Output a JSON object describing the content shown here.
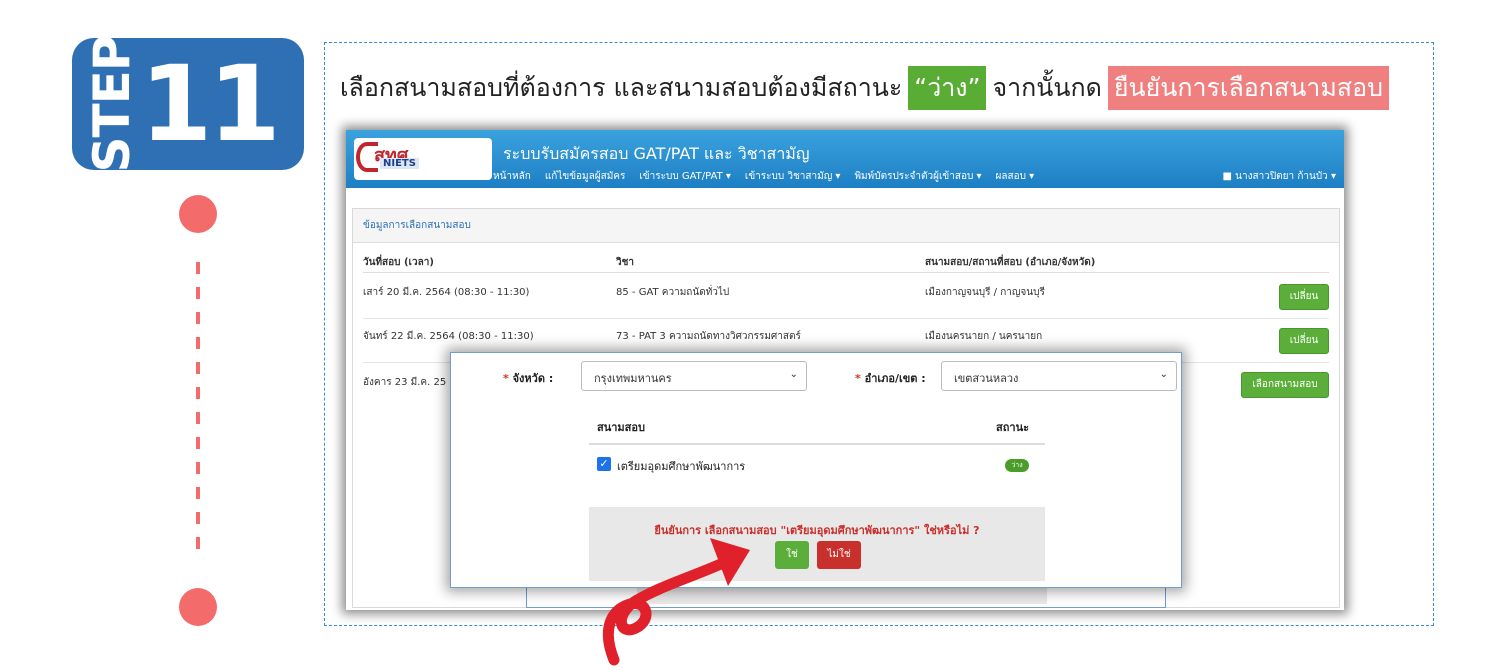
{
  "step": {
    "word": "STEP",
    "number": "11"
  },
  "instruction": {
    "prefix": "เลือกสนามสอบที่ต้องการ และสนามสอบต้องมีสถานะ",
    "status_word": "“ว่าง”",
    "middle": "จากนั้นกด",
    "action": "ยืนยันการเลือกสนามสอบ"
  },
  "navbar": {
    "logo_text": "สทศ",
    "logo_sub": "NIETS",
    "title": "ระบบรับสมัครสอบ GAT/PAT และ วิชาสามัญ",
    "menu": [
      "หน้าหลัก",
      "แก้ไขข้อมูลผู้สมัคร",
      "เข้าระบบ GAT/PAT ▾",
      "เข้าระบบ วิชาสามัญ ▾",
      "พิมพ์บัตรประจำตัวผู้เข้าสอบ ▾",
      "ผลสอบ ▾"
    ],
    "user": "นางสาวปิตยา ก้านบัว ▾"
  },
  "panel": {
    "title": "ข้อมูลการเลือกสนามสอบ",
    "headers": [
      "วันที่สอบ (เวลา)",
      "วิชา",
      "สนามสอบ/สถานที่สอบ (อำเภอ/จังหวัด)"
    ],
    "rows": [
      {
        "date": "เสาร์ 20 มี.ค. 2564   (08:30 - 11:30)",
        "subject": "85 - GAT ความถนัดทั่วไป",
        "venue": "เมืองกาญจนบุรี  /  กาญจนบุรี",
        "button": "เปลี่ยน"
      },
      {
        "date": "จันทร์ 22 มี.ค. 2564   (08:30 - 11:30)",
        "subject": "73 - PAT 3 ความถนัดทางวิศวกรรมศาสตร์",
        "venue": "เมืองนครนายก  /  นครนายก",
        "button": "เปลี่ยน"
      },
      {
        "date": "อังคาร 23 มี.ค. 25",
        "subject": "",
        "venue": "",
        "button": "เลือกสนามสอบ"
      }
    ]
  },
  "modal": {
    "province_label": "จังหวัด :",
    "province_value": "กรุงเทพมหานคร",
    "district_label": "อำเภอ/เขต :",
    "district_value": "เขตสวนหลวง",
    "required_mark": "*",
    "table_headers": [
      "สนามสอบ",
      "สถานะ"
    ],
    "venue_name": "เตรียมอุดมศึกษาพัฒนาการ",
    "venue_status": "ว่าง",
    "confirm_text": "ยืนยันการ เลือกสนามสอบ \"เตรียมอุดมศึกษาพัฒนาการ\" ใช่หรือไม่ ?",
    "yes": "ใช่",
    "no": "ไม่ใช่"
  },
  "colors": {
    "badge": "#2f70b4",
    "timeline": "#f36b6b",
    "green": "#5aad34",
    "red": "#f08080",
    "arrow": "#e0202a"
  }
}
